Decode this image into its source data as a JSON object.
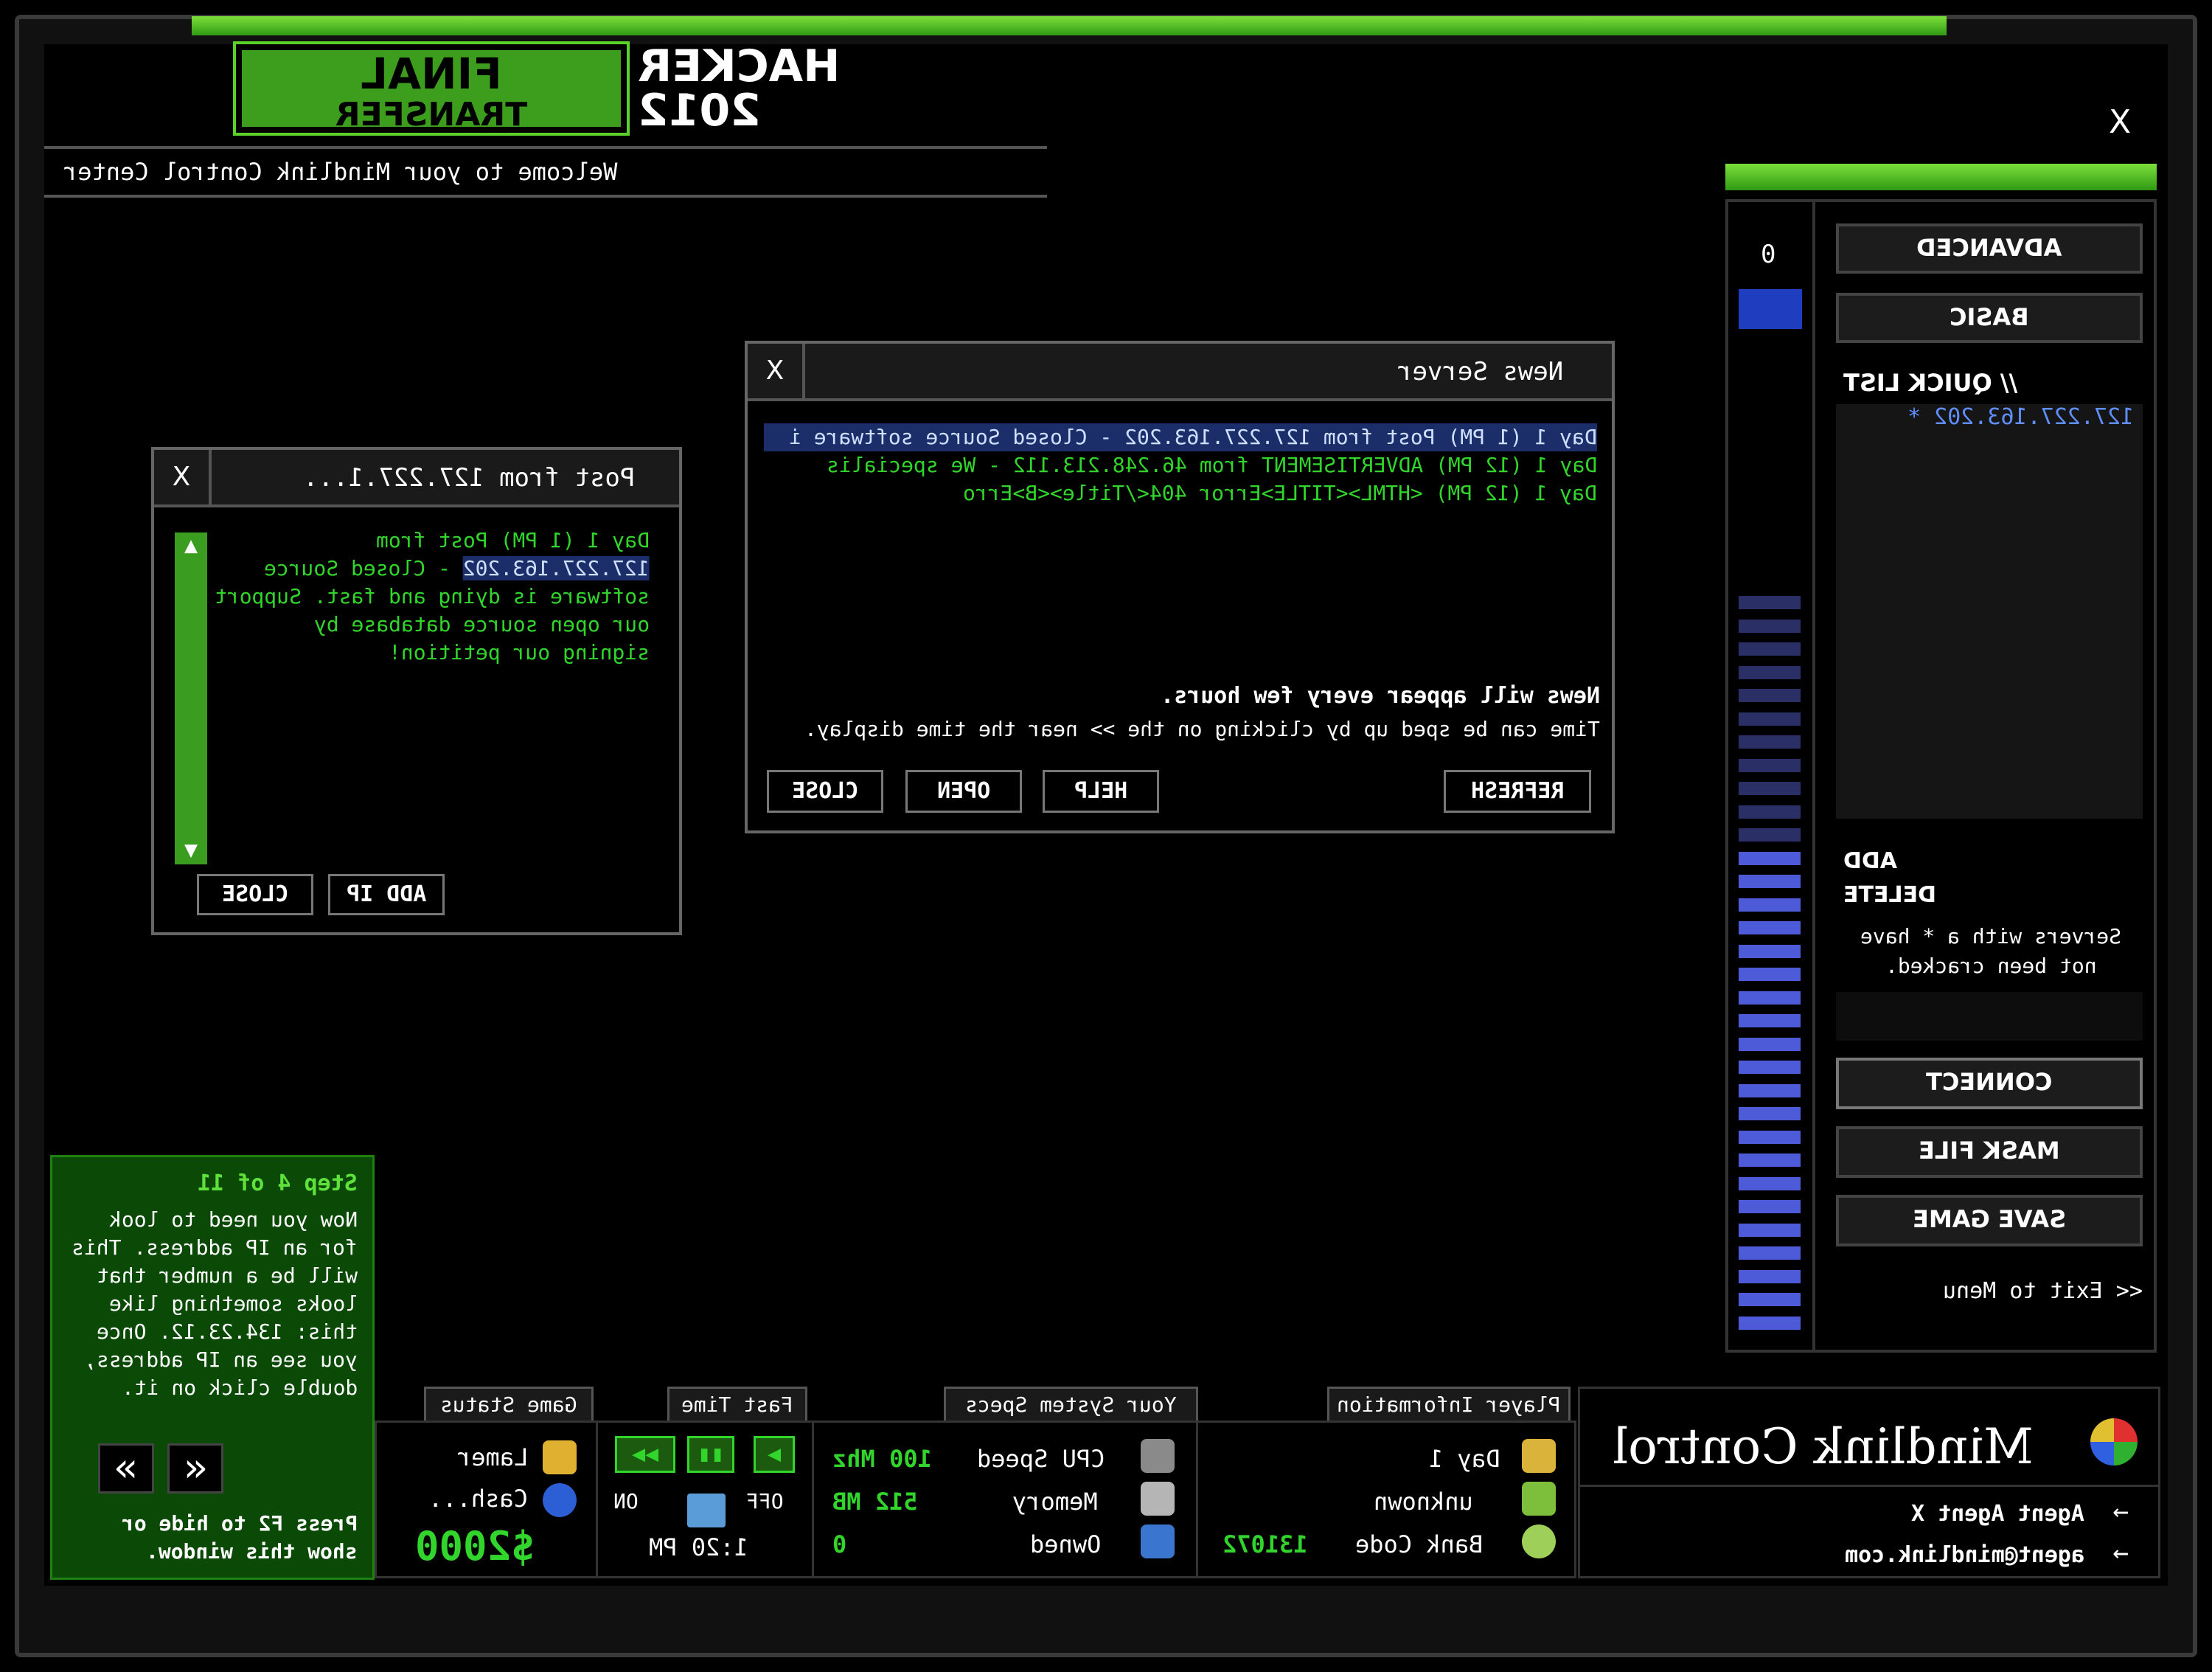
{
  "app": {
    "title_left_line1": "FINAL",
    "title_left_line2": "TRANSFER",
    "title_right_line1": "HACKER",
    "title_right_line2": "2012",
    "welcome": "Welcome to your Mindlink Control Center",
    "close_glyph": "X"
  },
  "post_window": {
    "title": "Post from 127.227.1...",
    "close": "X",
    "line1": "Day 1 (1 PM) Post from",
    "line2_sel": "127.227.163.202",
    "line2_rest": " - Closed Source",
    "line3": "software is dying and fast. Support",
    "line4": "our open source database by",
    "line5": "signing our petition!",
    "btn_add_ip": "ADD IP",
    "btn_close": "CLOSE"
  },
  "news_window": {
    "title": "News Server",
    "close": "X",
    "items": [
      "Day 1 (1 PM) Post from 127.227.163.202 - Closed Source software i",
      "Day 1 (12 PM) ADVERTISEMENT from 46.248.213.112 - We specialis",
      "Day 1 (12 PM) <HTML><TITLE>Error 404</Title><B>Erro"
    ],
    "info_bold": "News will appear every few hours.",
    "info": "Time can be sped up by clicking on the >> near the time display.",
    "btn_refresh": "REFRESH",
    "btn_help": "HELP",
    "btn_open": "OPEN",
    "btn_close": "CLOSE"
  },
  "sidebar": {
    "counter": "0",
    "btn_advanced": "ADVANCED",
    "btn_basic": "BASIC",
    "quick_list_label": "// QUICK LIST",
    "quick_list_items": [
      "127.227.163.202 *"
    ],
    "add": "ADD",
    "delete": "DELETE",
    "note_line1": "Servers with a * have",
    "note_line2": "not been cracked.",
    "btn_connect": "CONNECT",
    "btn_mask_file": "MASK FILE",
    "btn_save_game": "SAVE GAME",
    "exit": "<< Exit to Menu",
    "meter_level": 0.66,
    "meter_color": "#4e5bd8"
  },
  "tutorial": {
    "heading": "Step 4 of 11",
    "text": [
      "Now you need to look",
      "for an IP address. This",
      "will be a number that",
      "looks something like",
      "this: 134.23.12. Once",
      "you see an IP address,",
      "double click on it."
    ],
    "prev": "«",
    "next": "»",
    "hint1": "Press F2 to hide or",
    "hint2": "show this window."
  },
  "status_bar": {
    "tab_player": "Player Information",
    "tab_specs": "Your System Specs",
    "tab_fast": "Fast Time",
    "tab_status": "Game Status",
    "player_day": "Day 1",
    "player_name": "unknown",
    "bank_label": "Bank Code",
    "bank_value": "131072",
    "cpu_label": "CPU Speed",
    "cpu_value": "100 Mhz",
    "mem_label": "Memory",
    "mem_value": "512 MB",
    "owned_label": "Owned",
    "owned_value": "0",
    "fast_on": "ON",
    "fast_off": "OFF",
    "time": "1:20 PM",
    "status_rank": "Lamer",
    "status_cash_label": "Cash...",
    "status_cash": "$2000"
  },
  "mindlink": {
    "title": "Mindlink Control",
    "agent": "Agent Agent X",
    "email": "agent@mindlink.com",
    "arrow": "←"
  },
  "colors": {
    "accent_green": "#31d52b",
    "meter_blue": "#4e5bd8",
    "selection": "#1b2e6a"
  }
}
